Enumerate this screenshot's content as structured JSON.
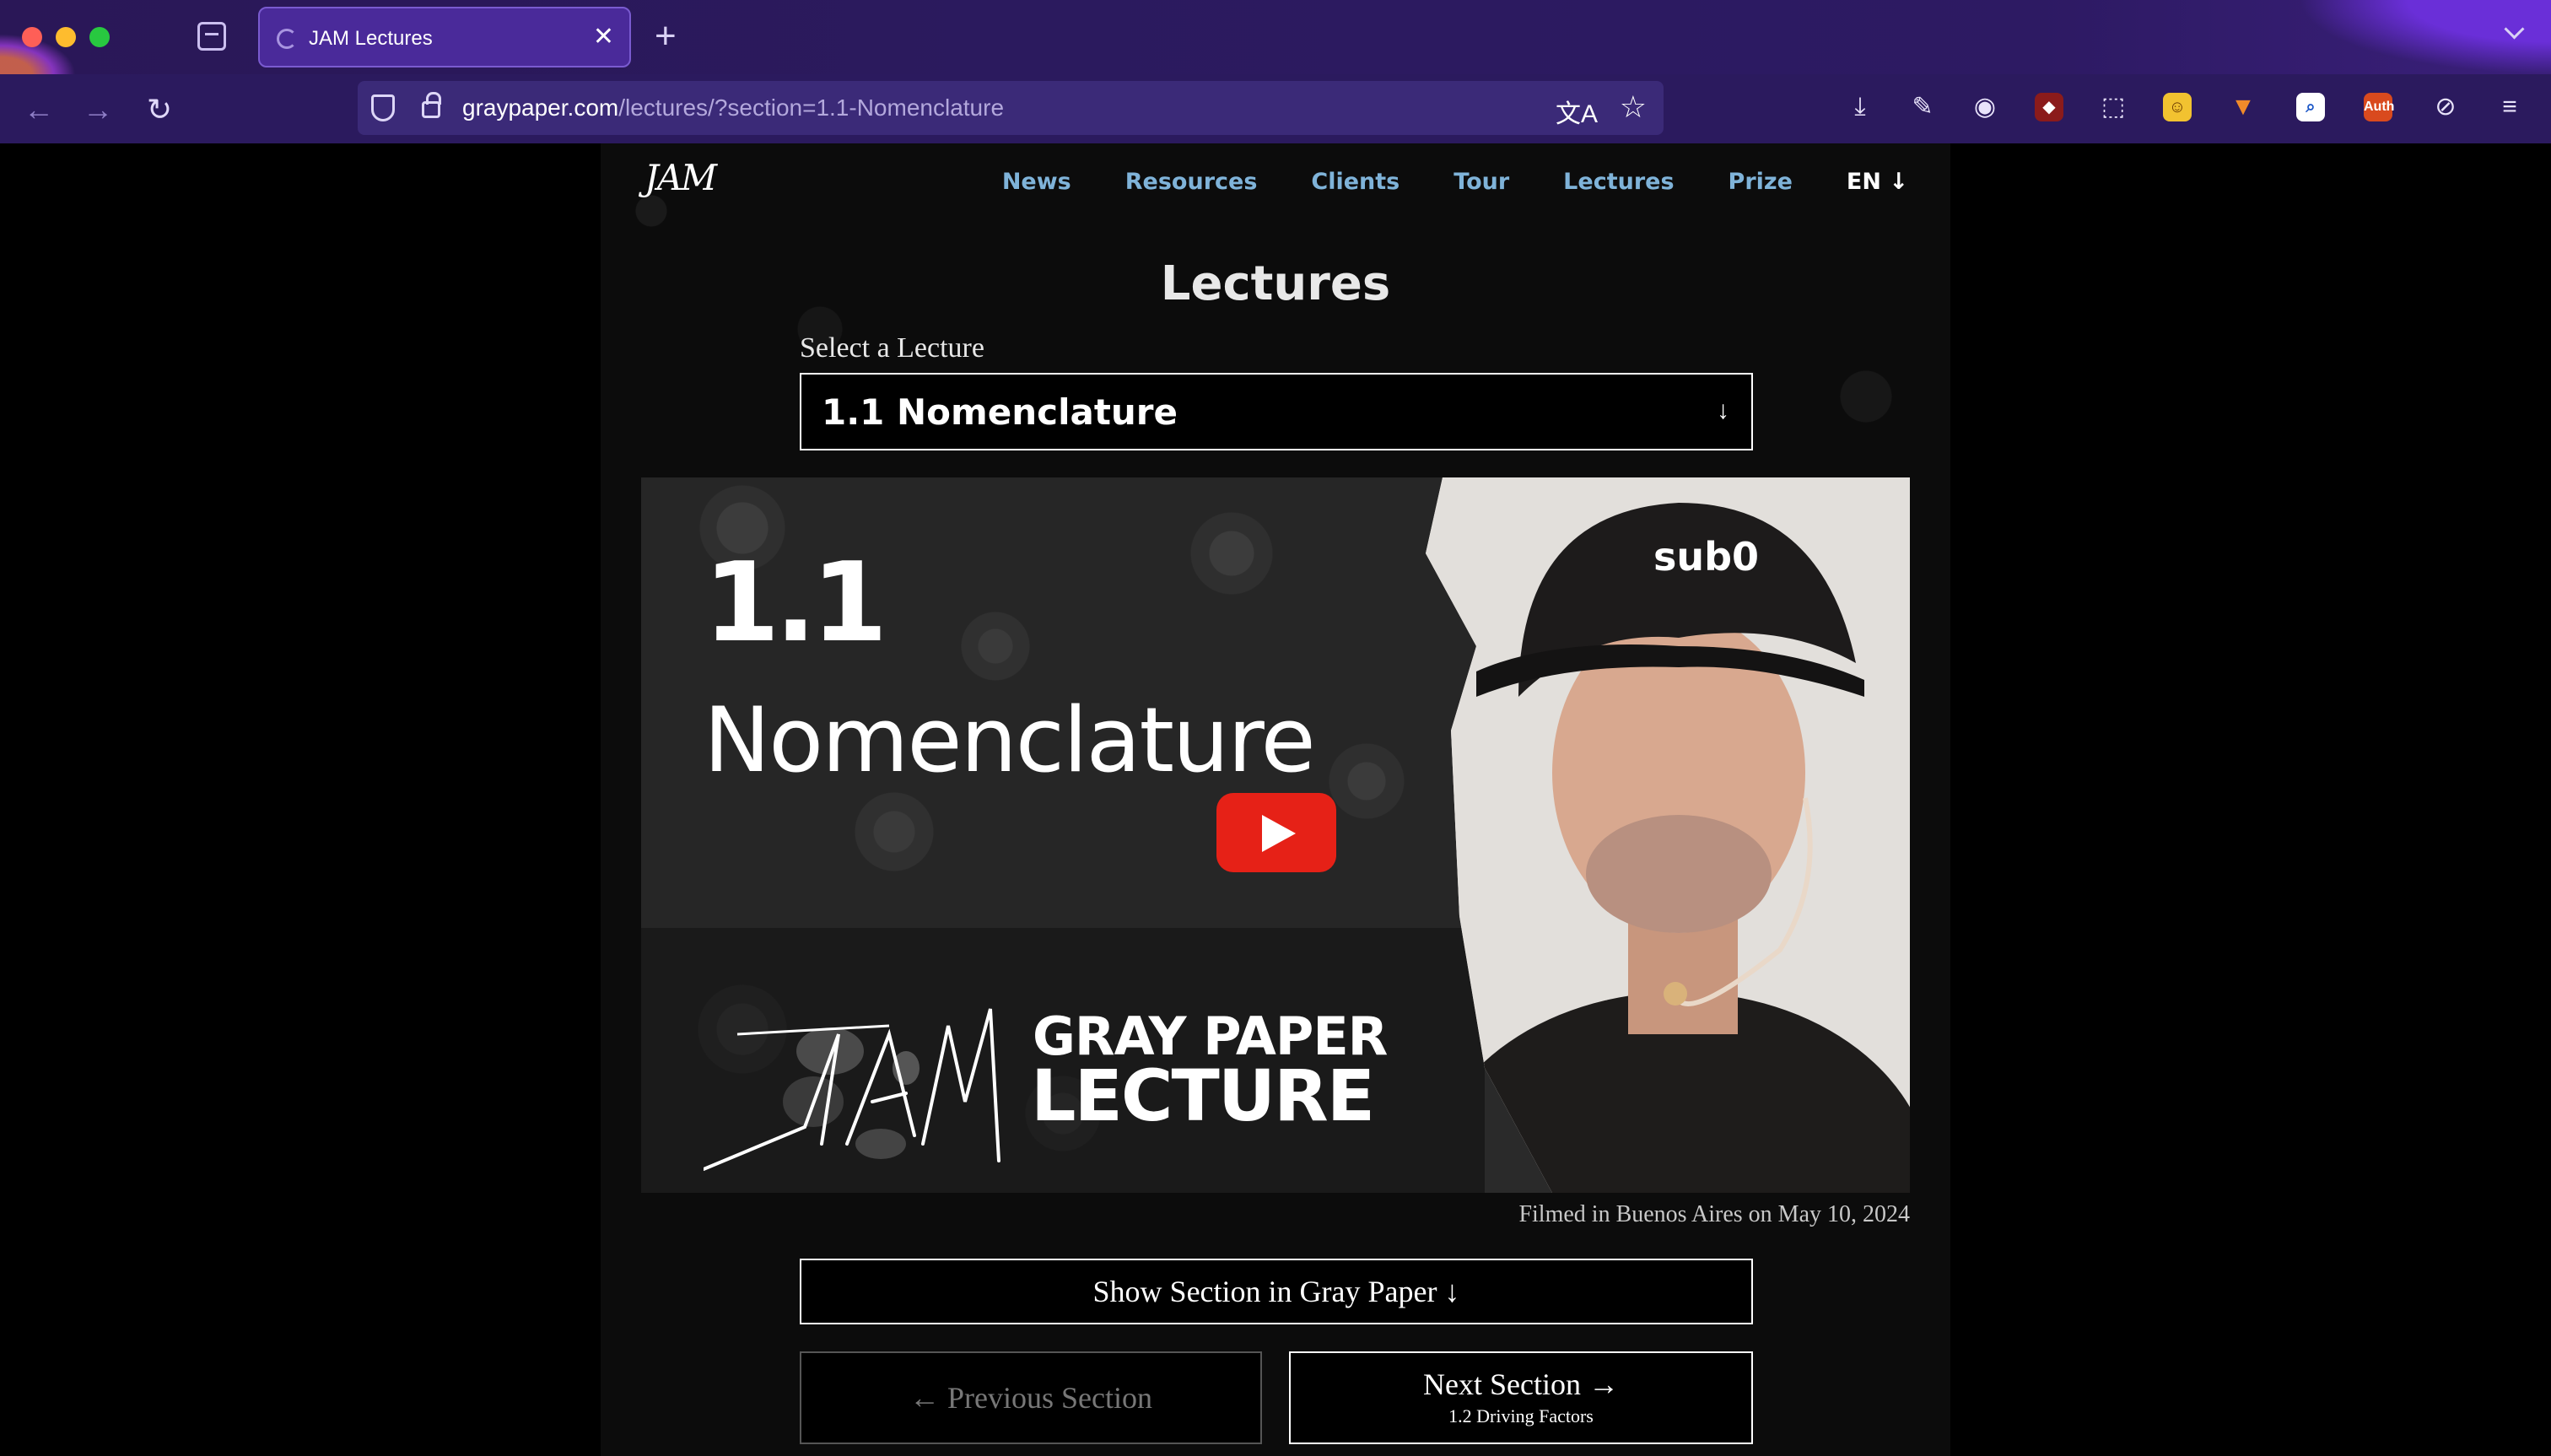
{
  "browser": {
    "tab_title": "JAM Lectures",
    "tab_close": "✕",
    "new_tab": "+",
    "url_domain": "graypaper.com",
    "url_path": "/lectures/?section=1.1-Nomenclature",
    "translate_glyph": "文A",
    "bookmark_glyph": "☆",
    "toolbar_icons": [
      "download-icon",
      "wrench-icon",
      "account-icon",
      "ublock-icon",
      "extensions-icon",
      "extension-face-icon",
      "metamask-icon",
      "search-extension-icon",
      "authenticator-icon",
      "tracking-icon",
      "menu-icon"
    ],
    "auth_badge": "Auth"
  },
  "site": {
    "logo": "JAM",
    "nav": {
      "news": "News",
      "resources": "Resources",
      "clients": "Clients",
      "tour": "Tour",
      "lectures": "Lectures",
      "prize": "Prize",
      "lang": "EN ↓"
    }
  },
  "main": {
    "title": "Lectures",
    "select_label": "Select a Lecture",
    "select_value": "1.1 Nomenclature",
    "select_arrow": "↓",
    "video": {
      "section_number": "1.1",
      "section_name": "Nomenclature",
      "brand_line1": "GRAY PAPER",
      "brand_line2": "LECTURE",
      "cap_text": "sub0"
    },
    "filmed": "Filmed in Buenos Aires on May 10, 2024",
    "show_section": "Show Section in Gray Paper ↓",
    "prev_section": "← Previous Section",
    "next_section": "Next Section →",
    "next_section_sub": "1.2 Driving Factors"
  }
}
